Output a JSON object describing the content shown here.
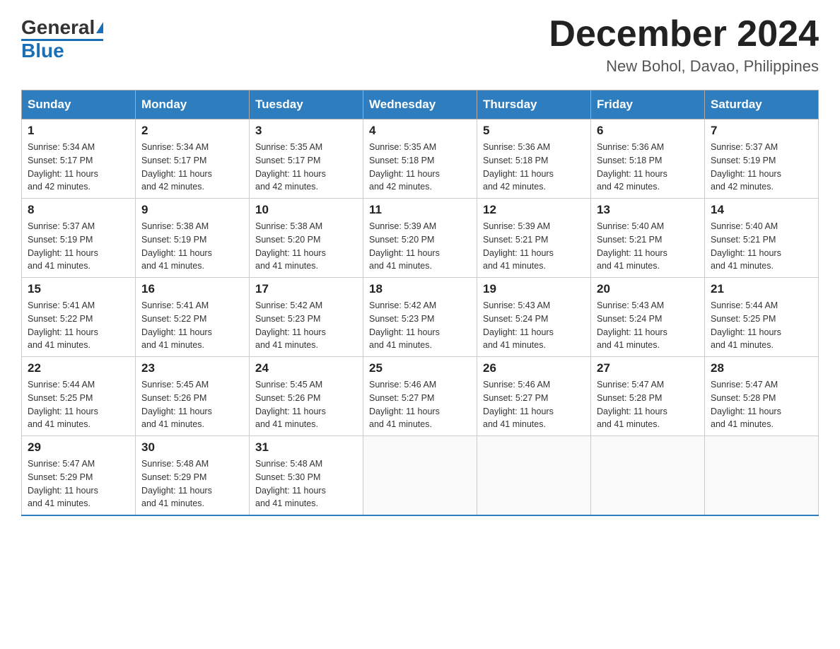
{
  "logo": {
    "general": "General",
    "blue": "Blue"
  },
  "title": {
    "month": "December 2024",
    "location": "New Bohol, Davao, Philippines"
  },
  "weekdays": [
    "Sunday",
    "Monday",
    "Tuesday",
    "Wednesday",
    "Thursday",
    "Friday",
    "Saturday"
  ],
  "weeks": [
    [
      {
        "day": "1",
        "sunrise": "5:34 AM",
        "sunset": "5:17 PM",
        "daylight": "11 hours and 42 minutes."
      },
      {
        "day": "2",
        "sunrise": "5:34 AM",
        "sunset": "5:17 PM",
        "daylight": "11 hours and 42 minutes."
      },
      {
        "day": "3",
        "sunrise": "5:35 AM",
        "sunset": "5:17 PM",
        "daylight": "11 hours and 42 minutes."
      },
      {
        "day": "4",
        "sunrise": "5:35 AM",
        "sunset": "5:18 PM",
        "daylight": "11 hours and 42 minutes."
      },
      {
        "day": "5",
        "sunrise": "5:36 AM",
        "sunset": "5:18 PM",
        "daylight": "11 hours and 42 minutes."
      },
      {
        "day": "6",
        "sunrise": "5:36 AM",
        "sunset": "5:18 PM",
        "daylight": "11 hours and 42 minutes."
      },
      {
        "day": "7",
        "sunrise": "5:37 AM",
        "sunset": "5:19 PM",
        "daylight": "11 hours and 42 minutes."
      }
    ],
    [
      {
        "day": "8",
        "sunrise": "5:37 AM",
        "sunset": "5:19 PM",
        "daylight": "11 hours and 41 minutes."
      },
      {
        "day": "9",
        "sunrise": "5:38 AM",
        "sunset": "5:19 PM",
        "daylight": "11 hours and 41 minutes."
      },
      {
        "day": "10",
        "sunrise": "5:38 AM",
        "sunset": "5:20 PM",
        "daylight": "11 hours and 41 minutes."
      },
      {
        "day": "11",
        "sunrise": "5:39 AM",
        "sunset": "5:20 PM",
        "daylight": "11 hours and 41 minutes."
      },
      {
        "day": "12",
        "sunrise": "5:39 AM",
        "sunset": "5:21 PM",
        "daylight": "11 hours and 41 minutes."
      },
      {
        "day": "13",
        "sunrise": "5:40 AM",
        "sunset": "5:21 PM",
        "daylight": "11 hours and 41 minutes."
      },
      {
        "day": "14",
        "sunrise": "5:40 AM",
        "sunset": "5:21 PM",
        "daylight": "11 hours and 41 minutes."
      }
    ],
    [
      {
        "day": "15",
        "sunrise": "5:41 AM",
        "sunset": "5:22 PM",
        "daylight": "11 hours and 41 minutes."
      },
      {
        "day": "16",
        "sunrise": "5:41 AM",
        "sunset": "5:22 PM",
        "daylight": "11 hours and 41 minutes."
      },
      {
        "day": "17",
        "sunrise": "5:42 AM",
        "sunset": "5:23 PM",
        "daylight": "11 hours and 41 minutes."
      },
      {
        "day": "18",
        "sunrise": "5:42 AM",
        "sunset": "5:23 PM",
        "daylight": "11 hours and 41 minutes."
      },
      {
        "day": "19",
        "sunrise": "5:43 AM",
        "sunset": "5:24 PM",
        "daylight": "11 hours and 41 minutes."
      },
      {
        "day": "20",
        "sunrise": "5:43 AM",
        "sunset": "5:24 PM",
        "daylight": "11 hours and 41 minutes."
      },
      {
        "day": "21",
        "sunrise": "5:44 AM",
        "sunset": "5:25 PM",
        "daylight": "11 hours and 41 minutes."
      }
    ],
    [
      {
        "day": "22",
        "sunrise": "5:44 AM",
        "sunset": "5:25 PM",
        "daylight": "11 hours and 41 minutes."
      },
      {
        "day": "23",
        "sunrise": "5:45 AM",
        "sunset": "5:26 PM",
        "daylight": "11 hours and 41 minutes."
      },
      {
        "day": "24",
        "sunrise": "5:45 AM",
        "sunset": "5:26 PM",
        "daylight": "11 hours and 41 minutes."
      },
      {
        "day": "25",
        "sunrise": "5:46 AM",
        "sunset": "5:27 PM",
        "daylight": "11 hours and 41 minutes."
      },
      {
        "day": "26",
        "sunrise": "5:46 AM",
        "sunset": "5:27 PM",
        "daylight": "11 hours and 41 minutes."
      },
      {
        "day": "27",
        "sunrise": "5:47 AM",
        "sunset": "5:28 PM",
        "daylight": "11 hours and 41 minutes."
      },
      {
        "day": "28",
        "sunrise": "5:47 AM",
        "sunset": "5:28 PM",
        "daylight": "11 hours and 41 minutes."
      }
    ],
    [
      {
        "day": "29",
        "sunrise": "5:47 AM",
        "sunset": "5:29 PM",
        "daylight": "11 hours and 41 minutes."
      },
      {
        "day": "30",
        "sunrise": "5:48 AM",
        "sunset": "5:29 PM",
        "daylight": "11 hours and 41 minutes."
      },
      {
        "day": "31",
        "sunrise": "5:48 AM",
        "sunset": "5:30 PM",
        "daylight": "11 hours and 41 minutes."
      },
      null,
      null,
      null,
      null
    ]
  ],
  "labels": {
    "sunrise": "Sunrise:",
    "sunset": "Sunset:",
    "daylight": "Daylight:"
  }
}
